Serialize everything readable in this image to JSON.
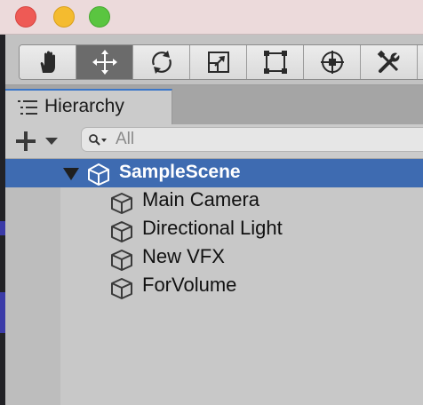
{
  "window": {
    "controls": [
      "close",
      "minimize",
      "zoom"
    ]
  },
  "toolbar": {
    "tools": [
      {
        "name": "hand-tool",
        "icon": "hand-icon"
      },
      {
        "name": "move-tool",
        "icon": "move-arrows-icon",
        "active": true
      },
      {
        "name": "rotate-tool",
        "icon": "rotate-icon"
      },
      {
        "name": "scale-tool",
        "icon": "scale-icon"
      },
      {
        "name": "rect-tool",
        "icon": "rect-transform-icon"
      },
      {
        "name": "transform-tool",
        "icon": "transform-icon"
      },
      {
        "name": "custom-tool",
        "icon": "tools-icon"
      }
    ]
  },
  "hierarchy": {
    "tab_label": "Hierarchy",
    "create_button": "+",
    "search_placeholder": "All",
    "scene": {
      "name": "SampleScene",
      "expanded": true
    },
    "objects": [
      {
        "name": "Main Camera"
      },
      {
        "name": "Directional Light"
      },
      {
        "name": "New VFX"
      },
      {
        "name": "ForVolume"
      }
    ]
  },
  "colors": {
    "selection": "#3e6bb1",
    "tab_accent": "#3c77c8",
    "active_tool": "#6b6b6b",
    "titlebar": "#ecdadb"
  }
}
